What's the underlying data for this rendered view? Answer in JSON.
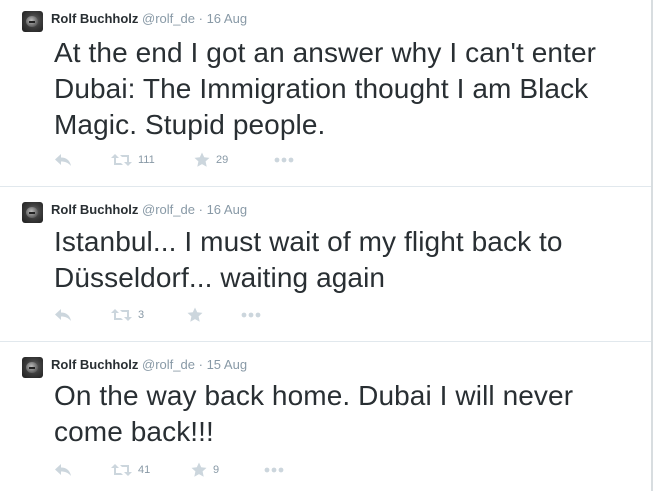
{
  "tweets": [
    {
      "author": "Rolf Buchholz",
      "handle": "@rolf_de",
      "separator": "·",
      "date": "16 Aug",
      "text": "At the end I got an answer why I can't enter Dubai: The Immigration thought I am Black Magic. Stupid people.",
      "retweets": "111",
      "favorites": "29"
    },
    {
      "author": "Rolf Buchholz",
      "handle": "@rolf_de",
      "separator": "·",
      "date": "16 Aug",
      "text": "Istanbul... I must wait of my flight back to Düsseldorf... waiting again",
      "retweets": "3",
      "favorites": ""
    },
    {
      "author": "Rolf Buchholz",
      "handle": "@rolf_de",
      "separator": "·",
      "date": "15 Aug",
      "text": "On the way back home. Dubai I will never come back!!!",
      "retweets": "41",
      "favorites": "9"
    }
  ],
  "icons": {
    "reply": "reply-icon",
    "retweet": "retweet-icon",
    "favorite": "star-icon",
    "more": "more-dots-icon"
  },
  "colors": {
    "text": "#292f33",
    "muted": "#8899a6",
    "icon": "#ccd6dd",
    "divider": "#e1e8ed"
  }
}
